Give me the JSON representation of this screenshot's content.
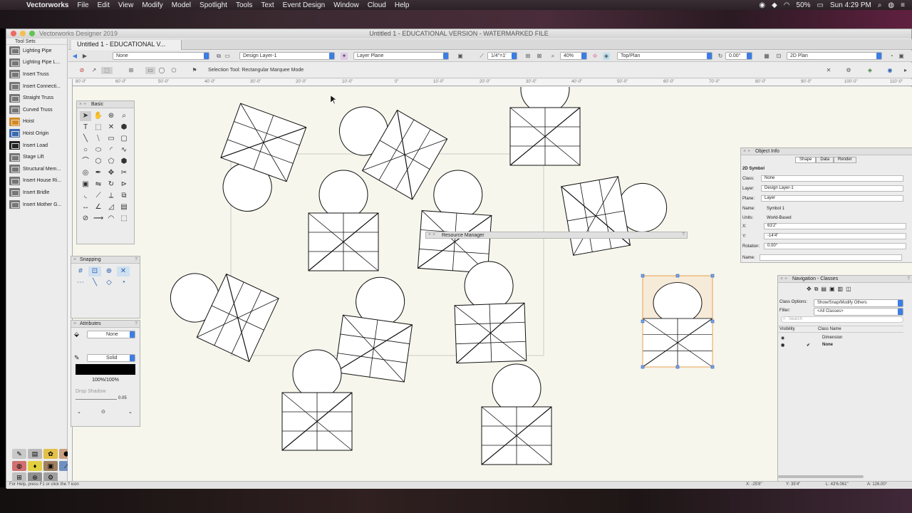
{
  "menubar": {
    "app": "Vectorworks",
    "items": [
      "File",
      "Edit",
      "View",
      "Modify",
      "Model",
      "Spotlight",
      "Tools",
      "Text",
      "Event Design",
      "Window",
      "Cloud",
      "Help"
    ],
    "battery": "50%",
    "clock": "Sun 4:29 PM"
  },
  "window": {
    "app_name": "Vectorworks Designer 2019",
    "title": "Untitled 1 - EDUCATIONAL VERSION - WATERMARKED FILE",
    "tab": "Untitled 1 - EDUCATIONAL V..."
  },
  "toolbar": {
    "class_select": "None",
    "layer_select": "Design Layer-1",
    "plane_select": "Layer Plane",
    "scale": "1/4\"=1'",
    "zoom": "40%",
    "view_select": "Top/Plan",
    "angle": "0.00°",
    "render_select": "2D Plan",
    "mode_text": "Selection Tool: Rectangular Marquee Mode"
  },
  "ruler": {
    "labels": [
      "80'-0\"",
      "60'-0\"",
      "50'-0\"",
      "40'-0\"",
      "30'-0\"",
      "20'-0\"",
      "10'-0\"",
      "0\"",
      "10'-0\"",
      "20'-0\"",
      "30'-0\"",
      "40'-0\"",
      "50'-0\"",
      "60'-0\"",
      "70'-0\"",
      "80'-0\"",
      "90'-0\"",
      "100'-0\"",
      "110'-0\""
    ]
  },
  "toolsets": {
    "title": "Tool Sets",
    "items": [
      "Lighting Pipe",
      "Lighting Pipe L...",
      "Insert Truss",
      "Insert Connecti...",
      "Straight Truss",
      "Curved Truss",
      "Hoist",
      "Hoist Origin",
      "Insert Load",
      "Stage Lift",
      "Structural Mem...",
      "Insert House Ri...",
      "Insert Bridle",
      "Insert Mother G..."
    ]
  },
  "basic_palette": {
    "title": "Basic"
  },
  "snapping_palette": {
    "title": "Snapping"
  },
  "attributes": {
    "title": "Attributes",
    "fill_value": "None",
    "pen_value": "Solid",
    "opacity": "100%/100%",
    "drop_shadow": "Drop Shadow",
    "line_weight": "0.05"
  },
  "resource_manager": {
    "title": "Resource Manager"
  },
  "object_info": {
    "title": "Object Info",
    "tabs": [
      "Shape",
      "Data",
      "Render"
    ],
    "object_type": "2D Symbol",
    "class_label": "Class:",
    "class_value": "None",
    "layer_label": "Layer:",
    "layer_value": "Design Layer-1",
    "plane_label": "Plane:",
    "plane_value": "Layer",
    "name_label": "Name:",
    "name_value": "Symbol 1",
    "units_label": "Units:",
    "units_value": "World-Based",
    "x_label": "X:",
    "x_value": "63'2\"",
    "y_label": "Y:",
    "y_value": "-14'4\"",
    "rotation_label": "Rotation:",
    "rotation_value": "0.00°",
    "name2_label": "Name:"
  },
  "navigation": {
    "title": "Navigation - Classes",
    "class_options_label": "Class Options:",
    "class_options_value": "Show/Snap/Modify Others",
    "filter_label": "Filter:",
    "filter_value": "<All Classes>",
    "search_placeholder": "Search",
    "col_visibility": "Visibility",
    "col_class_name": "Class Name",
    "classes": [
      "Dimension",
      "None"
    ]
  },
  "status": {
    "help": "For Help, press F1 or click the ? icon",
    "x": "X: -25'8\"",
    "y": "Y: 35'4\"",
    "l": "L: 43'6.061\"",
    "a": "A: 126.00°"
  },
  "colors": {
    "accent": "#3c7de4",
    "selection": "#e8a050",
    "canvas": "#f6f6ec"
  }
}
